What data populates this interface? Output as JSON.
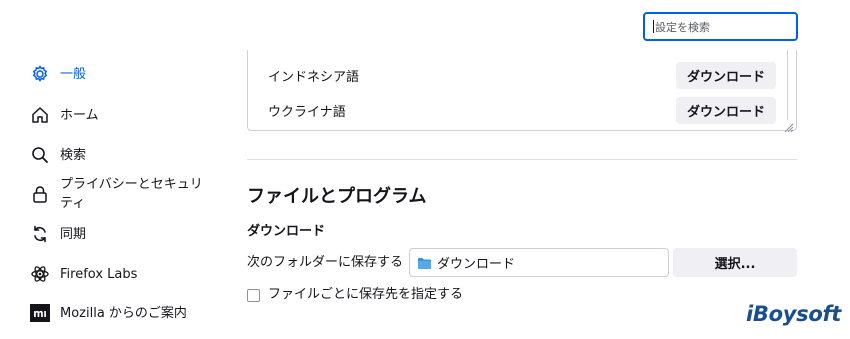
{
  "search": {
    "placeholder": "設定を検索"
  },
  "sidebar": {
    "items": [
      {
        "label": "一般",
        "icon": "gear-icon",
        "active": true
      },
      {
        "label": "ホーム",
        "icon": "home-icon"
      },
      {
        "label": "検索",
        "icon": "search-icon"
      },
      {
        "label": "プライバシーとセキュリティ",
        "icon": "lock-icon"
      },
      {
        "label": "同期",
        "icon": "sync-icon"
      },
      {
        "label": "Firefox Labs",
        "icon": "flask-icon"
      },
      {
        "label": "Mozilla からのご案内",
        "icon": "mozilla-icon"
      }
    ]
  },
  "languages": [
    {
      "name": "インドネシア語",
      "button": "ダウンロード"
    },
    {
      "name": "ウクライナ語",
      "button": "ダウンロード"
    }
  ],
  "files": {
    "section_title": "ファイルとプログラム",
    "downloads_title": "ダウンロード",
    "save_to_label": "次のフォルダーに保存する",
    "folder_value": "ダウンロード",
    "choose_button": "選択...",
    "ask_checkbox_label": "ファイルごとに保存先を指定する"
  },
  "watermark": "iBoysoft",
  "colors": {
    "accent": "#0061e0",
    "button_bg": "#f0f0f4",
    "folder": "#3d8fd6"
  }
}
